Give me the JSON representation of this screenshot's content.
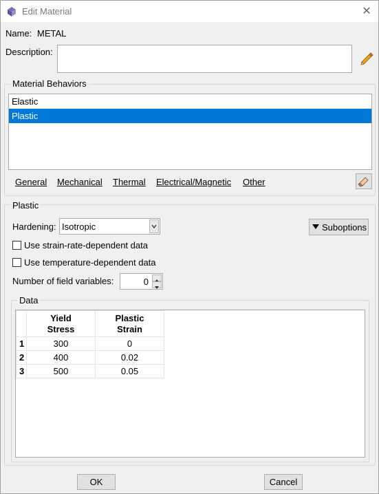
{
  "window": {
    "title": "Edit Material",
    "close_glyph": "✕"
  },
  "name": {
    "label": "Name:",
    "value": "METAL"
  },
  "description": {
    "label": "Description:",
    "value": ""
  },
  "behaviors": {
    "group_title": "Material Behaviors",
    "items": [
      {
        "label": "Elastic",
        "selected": false
      },
      {
        "label": "Plastic",
        "selected": true
      }
    ],
    "menu": [
      "General",
      "Mechanical",
      "Thermal",
      "Electrical/Magnetic",
      "Other"
    ]
  },
  "plastic": {
    "group_title": "Plastic",
    "hardening_label": "Hardening:",
    "hardening_value": "Isotropic",
    "suboptions_label": "Suboptions",
    "strain_rate_label": "Use strain-rate-dependent data",
    "strain_rate_checked": false,
    "temperature_label": "Use temperature-dependent data",
    "temperature_checked": false,
    "field_vars_label": "Number of field variables:",
    "field_vars_value": "0",
    "data_group_title": "Data",
    "columns": [
      {
        "line1": "Yield",
        "line2": "Stress"
      },
      {
        "line1": "Plastic",
        "line2": "Strain"
      }
    ],
    "rows": [
      {
        "num": "1",
        "stress": "300",
        "strain": "0"
      },
      {
        "num": "2",
        "stress": "400",
        "strain": "0.02"
      },
      {
        "num": "3",
        "stress": "500",
        "strain": "0.05"
      }
    ]
  },
  "buttons": {
    "ok": "OK",
    "cancel": "Cancel"
  },
  "colors": {
    "selection": "#0078d7",
    "accent_pencil": "#f0a020"
  }
}
